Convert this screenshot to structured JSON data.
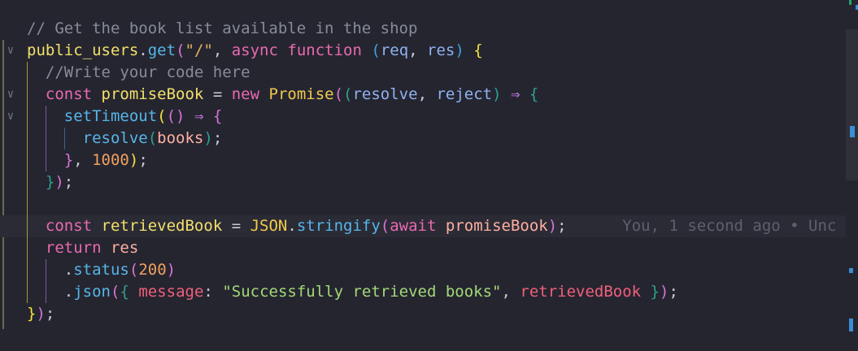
{
  "editor": {
    "lines": [
      {
        "tokens": [
          {
            "t": "// Get the book list available in the shop",
            "c": "t-cmt"
          }
        ]
      },
      {
        "tokens": [
          {
            "t": "public_users",
            "c": "t-var"
          },
          {
            "t": ".",
            "c": "t-punc"
          },
          {
            "t": "get",
            "c": "t-fn"
          },
          {
            "t": "(",
            "c": "t-br2"
          },
          {
            "t": "\"/\"",
            "c": "t-str"
          },
          {
            "t": ", ",
            "c": "t-punc"
          },
          {
            "t": "async",
            "c": "t-kw"
          },
          {
            "t": " ",
            "c": "t-plain"
          },
          {
            "t": "function",
            "c": "t-kw"
          },
          {
            "t": " ",
            "c": "t-plain"
          },
          {
            "t": "(",
            "c": "t-br3"
          },
          {
            "t": "req",
            "c": "t-param"
          },
          {
            "t": ", ",
            "c": "t-punc"
          },
          {
            "t": "res",
            "c": "t-param"
          },
          {
            "t": ")",
            "c": "t-br3"
          },
          {
            "t": " ",
            "c": "t-plain"
          },
          {
            "t": "{",
            "c": "t-br1"
          }
        ]
      },
      {
        "tokens": [
          {
            "t": "  //Write your code here",
            "c": "t-cmt"
          }
        ]
      },
      {
        "tokens": [
          {
            "t": "  ",
            "c": "t-plain"
          },
          {
            "t": "const",
            "c": "t-kw"
          },
          {
            "t": " ",
            "c": "t-plain"
          },
          {
            "t": "promiseBook",
            "c": "t-var"
          },
          {
            "t": " = ",
            "c": "t-punc"
          },
          {
            "t": "new",
            "c": "t-kw"
          },
          {
            "t": " ",
            "c": "t-plain"
          },
          {
            "t": "Promise",
            "c": "t-class"
          },
          {
            "t": "(",
            "c": "t-br2"
          },
          {
            "t": "(",
            "c": "t-br4"
          },
          {
            "t": "resolve",
            "c": "t-param"
          },
          {
            "t": ", ",
            "c": "t-punc"
          },
          {
            "t": "reject",
            "c": "t-param"
          },
          {
            "t": ")",
            "c": "t-br4"
          },
          {
            "t": " ⇒ ",
            "c": "t-op"
          },
          {
            "t": "{",
            "c": "t-br4"
          }
        ]
      },
      {
        "tokens": [
          {
            "t": "    ",
            "c": "t-plain"
          },
          {
            "t": "setTimeout",
            "c": "t-fn"
          },
          {
            "t": "(",
            "c": "t-br1"
          },
          {
            "t": "()",
            "c": "t-br2"
          },
          {
            "t": " ⇒ ",
            "c": "t-op"
          },
          {
            "t": "{",
            "c": "t-br2"
          }
        ]
      },
      {
        "tokens": [
          {
            "t": "      ",
            "c": "t-plain"
          },
          {
            "t": "resolve",
            "c": "t-fn"
          },
          {
            "t": "(",
            "c": "t-br4"
          },
          {
            "t": "books",
            "c": "t-ident"
          },
          {
            "t": ")",
            "c": "t-br4"
          },
          {
            "t": ";",
            "c": "t-punc"
          }
        ]
      },
      {
        "tokens": [
          {
            "t": "    ",
            "c": "t-plain"
          },
          {
            "t": "}",
            "c": "t-br2"
          },
          {
            "t": ", ",
            "c": "t-punc"
          },
          {
            "t": "1000",
            "c": "t-num"
          },
          {
            "t": ")",
            "c": "t-br1"
          },
          {
            "t": ";",
            "c": "t-punc"
          }
        ]
      },
      {
        "tokens": [
          {
            "t": "  ",
            "c": "t-plain"
          },
          {
            "t": "}",
            "c": "t-br4"
          },
          {
            "t": ")",
            "c": "t-br2"
          },
          {
            "t": ";",
            "c": "t-punc"
          }
        ]
      },
      {
        "tokens": []
      },
      {
        "tokens": [
          {
            "t": "  ",
            "c": "t-plain"
          },
          {
            "t": "const",
            "c": "t-kw"
          },
          {
            "t": " ",
            "c": "t-plain"
          },
          {
            "t": "retrievedBook",
            "c": "t-var"
          },
          {
            "t": " = ",
            "c": "t-punc"
          },
          {
            "t": "JSON",
            "c": "t-class"
          },
          {
            "t": ".",
            "c": "t-punc"
          },
          {
            "t": "stringify",
            "c": "t-fn"
          },
          {
            "t": "(",
            "c": "t-br2"
          },
          {
            "t": "await",
            "c": "t-kw"
          },
          {
            "t": " ",
            "c": "t-plain"
          },
          {
            "t": "promiseBook",
            "c": "t-ident"
          },
          {
            "t": ")",
            "c": "t-br2"
          },
          {
            "t": ";",
            "c": "t-punc"
          },
          {
            "t": "      ",
            "c": "t-plain"
          },
          {
            "t": "You, 1 second ago • Unc",
            "c": "blame"
          }
        ],
        "current": true
      },
      {
        "tokens": [
          {
            "t": "  ",
            "c": "t-plain"
          },
          {
            "t": "return",
            "c": "t-kw"
          },
          {
            "t": " ",
            "c": "t-plain"
          },
          {
            "t": "res",
            "c": "t-ident"
          }
        ]
      },
      {
        "tokens": [
          {
            "t": "    ",
            "c": "t-plain"
          },
          {
            "t": ".",
            "c": "t-punc"
          },
          {
            "t": "status",
            "c": "t-fn"
          },
          {
            "t": "(",
            "c": "t-br2"
          },
          {
            "t": "200",
            "c": "t-num"
          },
          {
            "t": ")",
            "c": "t-br2"
          }
        ]
      },
      {
        "tokens": [
          {
            "t": "    ",
            "c": "t-plain"
          },
          {
            "t": ".",
            "c": "t-punc"
          },
          {
            "t": "json",
            "c": "t-fn"
          },
          {
            "t": "(",
            "c": "t-br2"
          },
          {
            "t": "{",
            "c": "t-br4"
          },
          {
            "t": " ",
            "c": "t-plain"
          },
          {
            "t": "message",
            "c": "t-prop"
          },
          {
            "t": ": ",
            "c": "t-punc"
          },
          {
            "t": "\"Successfully retrieved books\"",
            "c": "t-green"
          },
          {
            "t": ", ",
            "c": "t-punc"
          },
          {
            "t": "retrievedBook",
            "c": "t-prop"
          },
          {
            "t": " ",
            "c": "t-plain"
          },
          {
            "t": "}",
            "c": "t-br4"
          },
          {
            "t": ")",
            "c": "t-br2"
          },
          {
            "t": ";",
            "c": "t-punc"
          }
        ]
      },
      {
        "tokens": [
          {
            "t": "}",
            "c": "t-br1"
          },
          {
            "t": ")",
            "c": "t-br2"
          },
          {
            "t": ";",
            "c": "t-punc"
          }
        ]
      }
    ],
    "folds": [
      1,
      3,
      4
    ]
  }
}
